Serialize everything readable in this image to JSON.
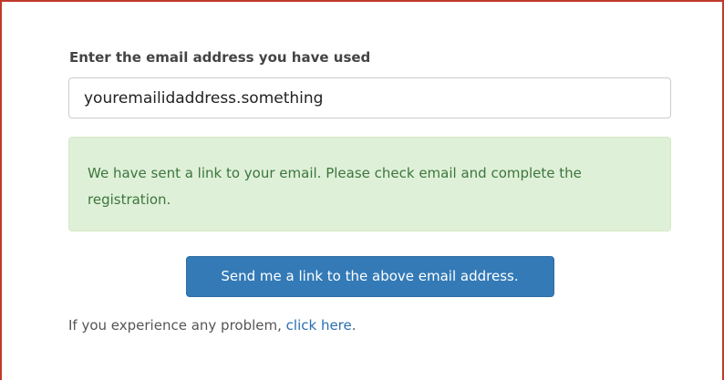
{
  "form": {
    "label": "Enter the email address you have used",
    "email_value": "youremailidaddress.something",
    "alert_message": "We have sent a link to your email. Please check email and complete the registration.",
    "submit_label": "Send me a link to the above email address.",
    "help_prefix": "If you experience any problem, ",
    "help_link": "click here",
    "help_suffix": "."
  },
  "colors": {
    "frame_border": "#c0392b",
    "alert_background": "#dff0d8",
    "alert_text": "#3c763d",
    "button_background": "#337ab7",
    "link": "#2a6fb0"
  }
}
